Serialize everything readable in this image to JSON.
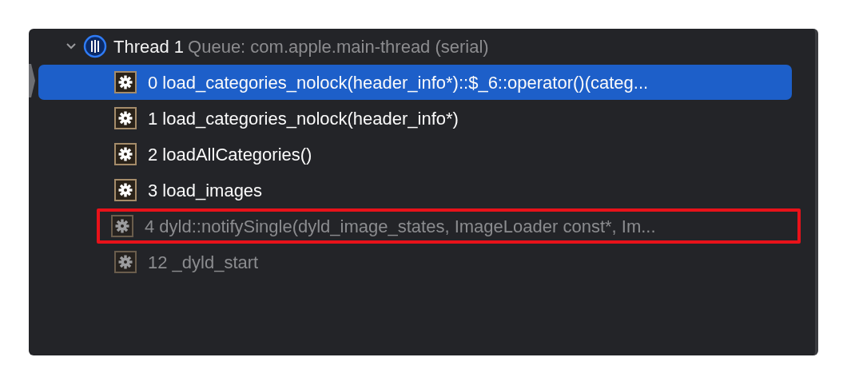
{
  "thread": {
    "expanded": true,
    "title": "Thread 1",
    "queue": "Queue: com.apple.main-thread (serial)"
  },
  "frames": [
    {
      "label": "0 load_categories_nolock(header_info*)::$_6::operator()(categ...",
      "selected": true,
      "dimmed": false,
      "highlighted": false
    },
    {
      "label": "1 load_categories_nolock(header_info*)",
      "selected": false,
      "dimmed": false,
      "highlighted": false
    },
    {
      "label": "2 loadAllCategories()",
      "selected": false,
      "dimmed": false,
      "highlighted": false
    },
    {
      "label": "3 load_images",
      "selected": false,
      "dimmed": false,
      "highlighted": false
    },
    {
      "label": "4 dyld::notifySingle(dyld_image_states, ImageLoader const*, Im...",
      "selected": false,
      "dimmed": true,
      "highlighted": true
    },
    {
      "label": "12 _dyld_start",
      "selected": false,
      "dimmed": true,
      "highlighted": false
    }
  ]
}
